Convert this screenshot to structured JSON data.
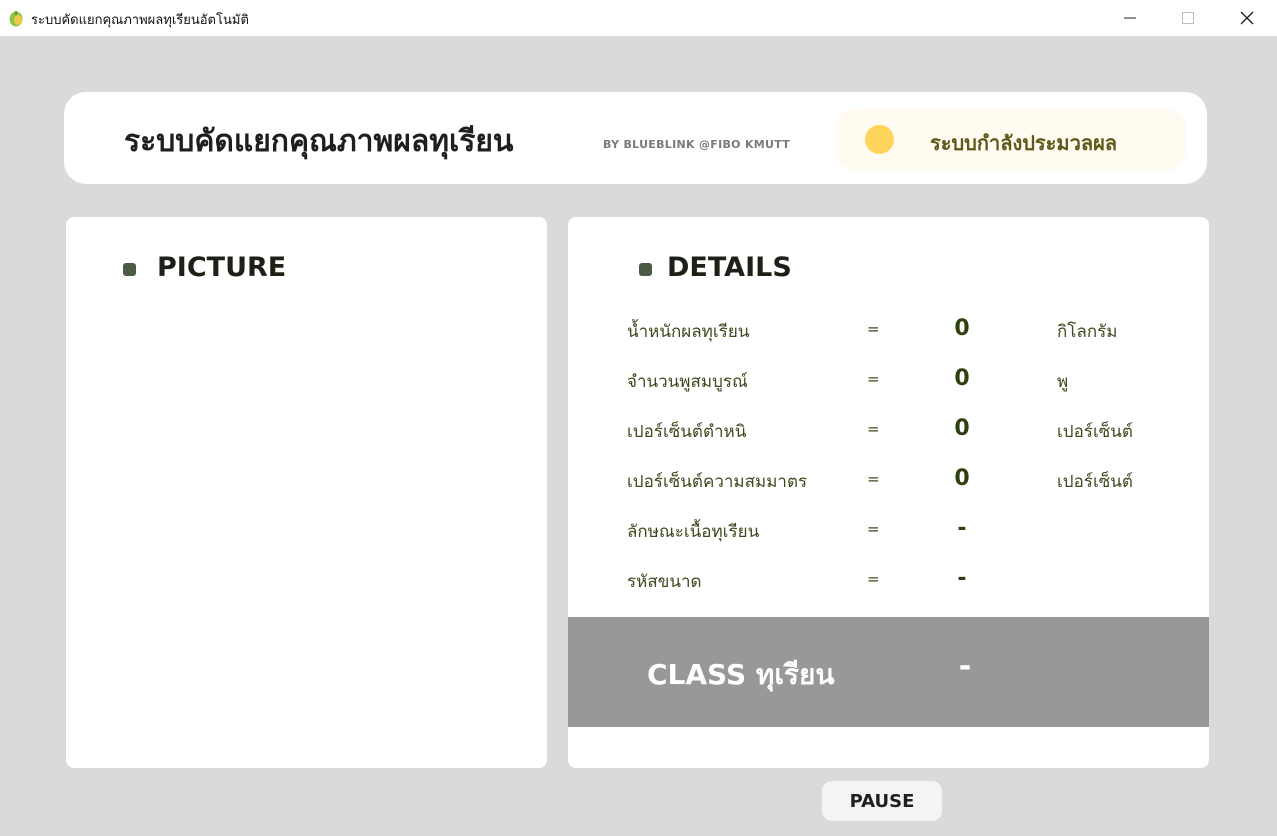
{
  "window": {
    "title": "ระบบคัดแยกคุณภาพผลทุเรียนอัตโนมัติ",
    "icon": "durian-leaf-icon"
  },
  "header": {
    "title": "ระบบคัดแยกคุณภาพผลทุเรียน",
    "byline": "BY BLUEBLINK @FIBO KMUTT",
    "status": {
      "text": "ระบบกำลังประมวลผล",
      "dot_color": "#ffd45a"
    }
  },
  "picture_panel": {
    "title": "PICTURE"
  },
  "details_panel": {
    "title": "DETAILS",
    "rows": [
      {
        "label": "น้ำหนักผลทุเรียน",
        "eq": "=",
        "value": "0",
        "unit": "กิโลกรัม"
      },
      {
        "label": "จำนวนพูสมบูรณ์",
        "eq": "=",
        "value": "0",
        "unit": "พู"
      },
      {
        "label": "เปอร์เซ็นต์ตำหนิ",
        "eq": "=",
        "value": "0",
        "unit": "เปอร์เซ็นต์"
      },
      {
        "label": "เปอร์เซ็นต์ความสมมาตร",
        "eq": "=",
        "value": "0",
        "unit": "เปอร์เซ็นต์"
      },
      {
        "label": "ลักษณะเนื้อทุเรียน",
        "eq": "=",
        "value": "-",
        "unit": ""
      },
      {
        "label": "รหัสขนาด",
        "eq": "=",
        "value": "-",
        "unit": ""
      }
    ],
    "class": {
      "label": "CLASS ทุเรียน",
      "value": "-"
    }
  },
  "controls": {
    "pause_label": "PAUSE"
  },
  "colors": {
    "background": "#dadada",
    "class_bar": "#989898",
    "status_bg": "#fffbf1",
    "accent_text": "#5c5a18"
  }
}
